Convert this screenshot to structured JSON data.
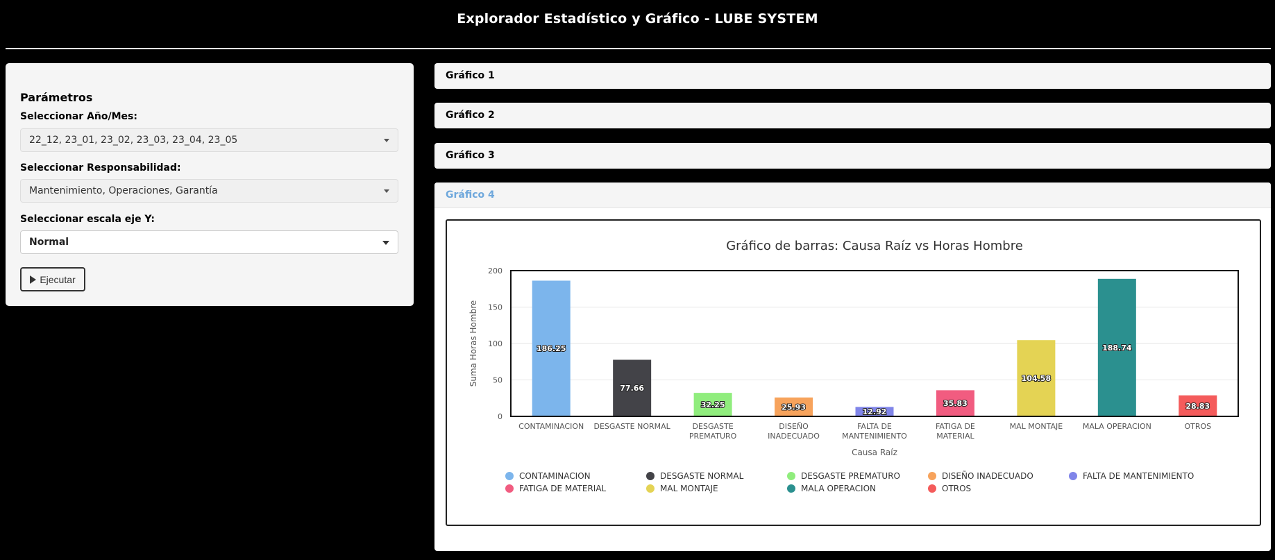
{
  "app": {
    "title": "Explorador Estadístico y Gráfico - LUBE SYSTEM"
  },
  "sidebar": {
    "heading": "Parámetros",
    "period_label": "Seleccionar Año/Mes:",
    "period_value": "22_12, 23_01, 23_02, 23_03, 23_04, 23_05",
    "resp_label": "Seleccionar Responsabilidad:",
    "resp_value": "Mantenimiento, Operaciones, Garantía",
    "scale_label": "Seleccionar escala eje Y:",
    "scale_value": "Normal",
    "run_label": "Ejecutar"
  },
  "panels": [
    {
      "label": "Gráfico 1"
    },
    {
      "label": "Gráfico 2"
    },
    {
      "label": "Gráfico 3"
    },
    {
      "label": "Gráfico 4"
    }
  ],
  "chart_data": {
    "type": "bar",
    "title": "Gráfico de barras: Causa Raíz vs Horas Hombre",
    "xlabel": "Causa Raíz",
    "ylabel": "Suma Horas Hombre",
    "ylim": [
      0,
      200
    ],
    "yticks": [
      0,
      50,
      100,
      150,
      200
    ],
    "grid": true,
    "legend_position": "bottom",
    "categories": [
      "CONTAMINACION",
      "DESGASTE NORMAL",
      "DESGASTE PREMATURO",
      "DISEÑO INADECUADO",
      "FALTA DE MANTENIMIENTO",
      "FATIGA DE MATERIAL",
      "MAL MONTAJE",
      "MALA OPERACION",
      "OTROS"
    ],
    "axis_labels": [
      [
        "CONTAMINACION"
      ],
      [
        "DESGASTE NORMAL"
      ],
      [
        "DESGASTE",
        "PREMATURO"
      ],
      [
        "DISEÑO",
        "INADECUADO"
      ],
      [
        "FALTA DE",
        "MANTENIMIENTO"
      ],
      [
        "FATIGA DE",
        "MATERIAL"
      ],
      [
        "MAL MONTAJE"
      ],
      [
        "MALA OPERACION"
      ],
      [
        "OTROS"
      ]
    ],
    "values": [
      186.25,
      77.66,
      32.25,
      25.93,
      12.92,
      35.83,
      104.58,
      188.74,
      28.83
    ],
    "colors": [
      "#7cb5ec",
      "#434348",
      "#90ed7d",
      "#f7a35c",
      "#8085e9",
      "#f15c80",
      "#e4d354",
      "#2b908f",
      "#f45b5b"
    ]
  }
}
